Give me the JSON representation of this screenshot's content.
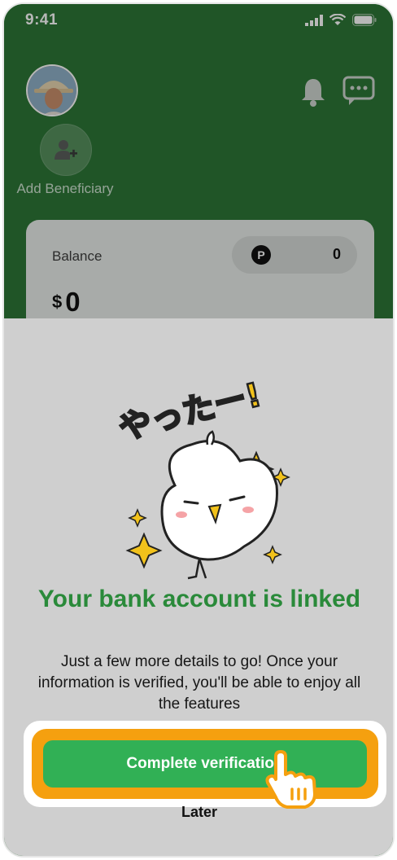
{
  "status_bar": {
    "time": "9:41",
    "icons": [
      "signal-icon",
      "wifi-icon",
      "battery-icon"
    ]
  },
  "header": {
    "avatar": "avatar",
    "bell_icon": "bell-icon",
    "chat_icon": "chat-icon",
    "add_beneficiary": {
      "icon": "add-person-icon",
      "label": "Add Beneficiary"
    }
  },
  "balance_card": {
    "label": "Balance",
    "points_badge": "P",
    "points": "0",
    "currency": "$",
    "amount": "0"
  },
  "modal": {
    "title": "Your bank account is linked",
    "subtitle": "Just a few more details to go! Once your information is verified, you'll be able to enjoy all the features",
    "primary_button": "Complete verification",
    "secondary_button": "Later",
    "sticker_text": "やったー!"
  },
  "colors": {
    "brand_green": "#2d7636",
    "button_green": "#31b055",
    "title_green": "#2a8a3a",
    "highlight_orange": "#f5a00f",
    "sticker_yellow": "#f2c21b"
  }
}
